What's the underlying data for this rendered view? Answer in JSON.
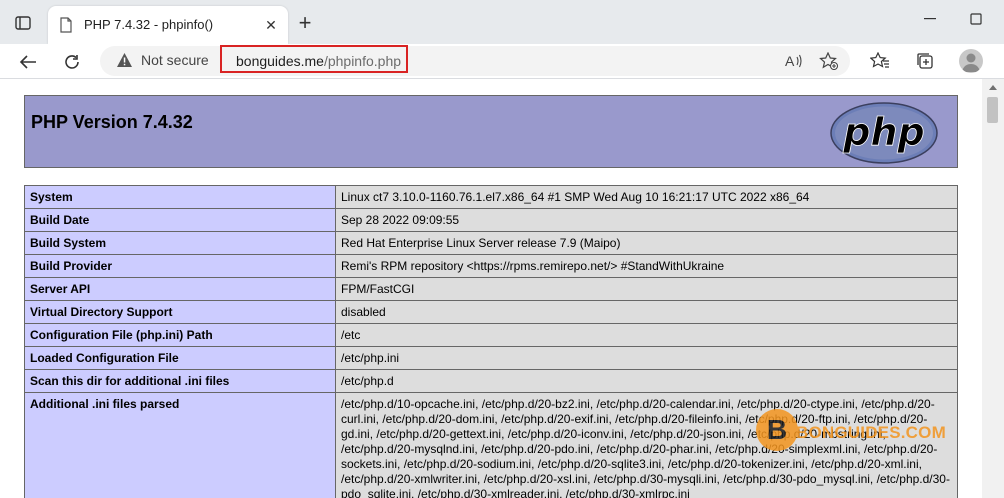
{
  "browser": {
    "tab": {
      "title": "PHP 7.4.32 - phpinfo()"
    },
    "address": {
      "security_label": "Not secure",
      "url_host": "bonguides.me",
      "url_path": "/phpinfo.php"
    }
  },
  "phpinfo": {
    "version_title": "PHP Version 7.4.32",
    "logo_text": "php",
    "rows": [
      {
        "key": "System",
        "value": "Linux ct7 3.10.0-1160.76.1.el7.x86_64 #1 SMP Wed Aug 10 16:21:17 UTC 2022 x86_64"
      },
      {
        "key": "Build Date",
        "value": "Sep 28 2022 09:09:55"
      },
      {
        "key": "Build System",
        "value": "Red Hat Enterprise Linux Server release 7.9 (Maipo)"
      },
      {
        "key": "Build Provider",
        "value": "Remi's RPM repository <https://rpms.remirepo.net/> #StandWithUkraine"
      },
      {
        "key": "Server API",
        "value": "FPM/FastCGI"
      },
      {
        "key": "Virtual Directory Support",
        "value": "disabled"
      },
      {
        "key": "Configuration File (php.ini) Path",
        "value": "/etc"
      },
      {
        "key": "Loaded Configuration File",
        "value": "/etc/php.ini"
      },
      {
        "key": "Scan this dir for additional .ini files",
        "value": "/etc/php.d"
      },
      {
        "key": "Additional .ini files parsed",
        "value": "/etc/php.d/10-opcache.ini, /etc/php.d/20-bz2.ini, /etc/php.d/20-calendar.ini, /etc/php.d/20-ctype.ini, /etc/php.d/20-curl.ini, /etc/php.d/20-dom.ini, /etc/php.d/20-exif.ini, /etc/php.d/20-fileinfo.ini, /etc/php.d/20-ftp.ini, /etc/php.d/20-gd.ini, /etc/php.d/20-gettext.ini, /etc/php.d/20-iconv.ini, /etc/php.d/20-json.ini, /etc/php.d/20-mbstring.ini, /etc/php.d/20-mysqlnd.ini, /etc/php.d/20-pdo.ini, /etc/php.d/20-phar.ini, /etc/php.d/20-simplexml.ini, /etc/php.d/20-sockets.ini, /etc/php.d/20-sodium.ini, /etc/php.d/20-sqlite3.ini, /etc/php.d/20-tokenizer.ini, /etc/php.d/20-xml.ini, /etc/php.d/20-xmlwriter.ini, /etc/php.d/20-xsl.ini, /etc/php.d/30-mysqli.ini, /etc/php.d/30-pdo_mysql.ini, /etc/php.d/30-pdo_sqlite.ini, /etc/php.d/30-xmlreader.ini, /etc/php.d/30-xmlrpc.ini"
      }
    ]
  },
  "watermark": {
    "letter": "B",
    "text": "BONGUIDES.COM"
  }
}
